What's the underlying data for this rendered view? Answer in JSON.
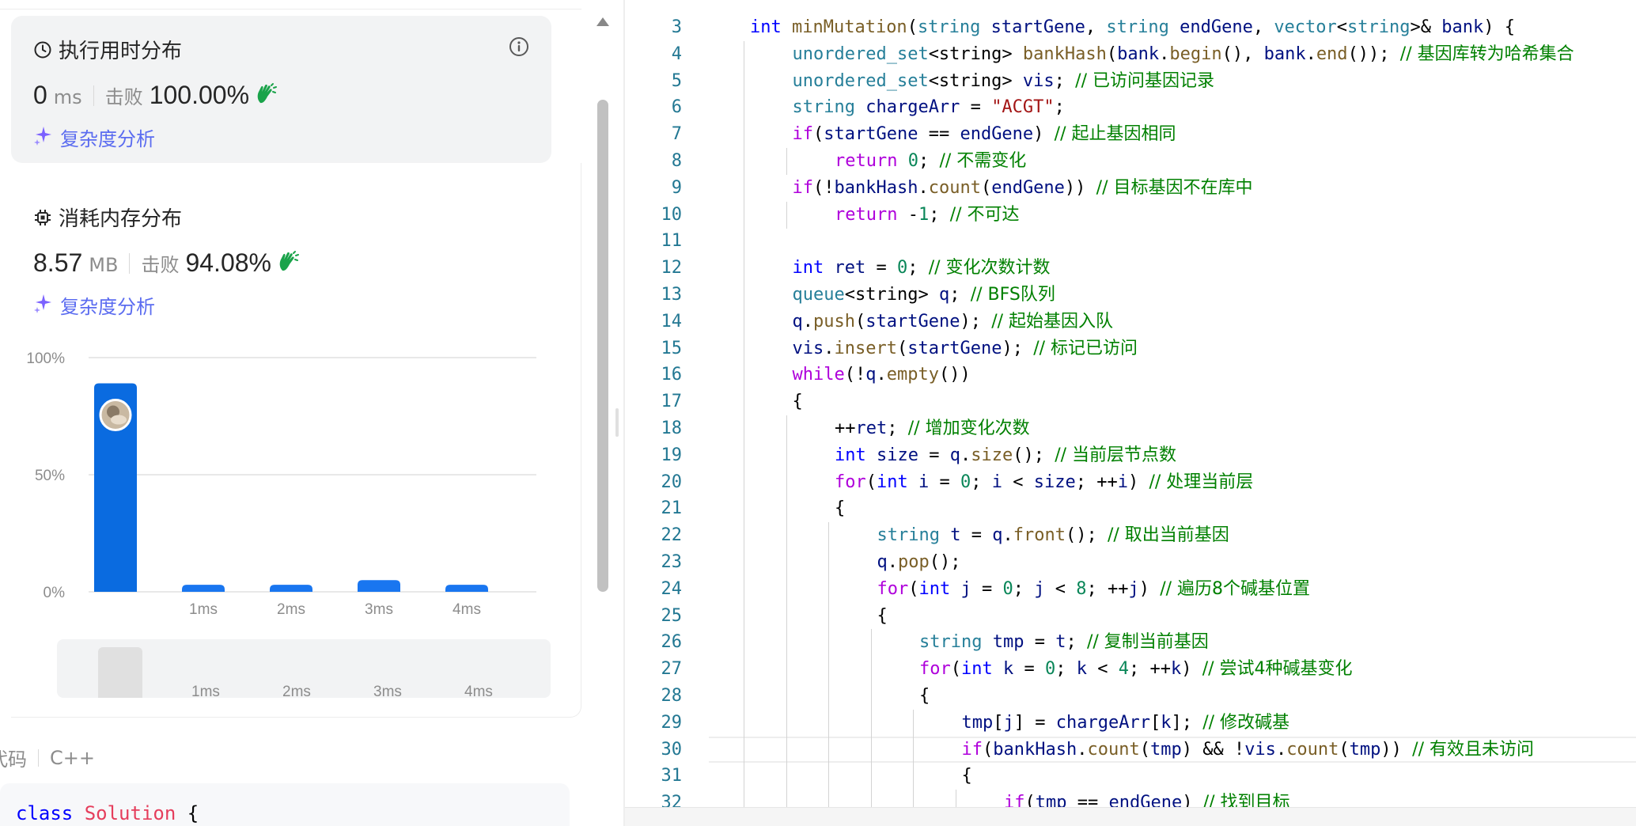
{
  "runtime": {
    "title": "执行用时分布",
    "value": "0",
    "unit": "ms",
    "beats_label": "击败",
    "beats_pct": "100.00%",
    "analysis_label": "复杂度分析"
  },
  "memory": {
    "title": "消耗内存分布",
    "value": "8.57",
    "unit": "MB",
    "beats_label": "击败",
    "beats_pct": "94.08%",
    "analysis_label": "复杂度分析"
  },
  "chart_data": {
    "type": "bar",
    "categories": [
      "",
      "1ms",
      "2ms",
      "3ms",
      "4ms"
    ],
    "values": [
      89,
      3,
      3,
      5,
      3
    ],
    "y_ticks": [
      "100%",
      "50%",
      "0%"
    ],
    "ylim": [
      0,
      100
    ],
    "bar_color": "#0a6be0",
    "highlight_color": "#1976f0",
    "grid": true
  },
  "mini_chart": {
    "labels": [
      "1ms",
      "2ms",
      "3ms",
      "4ms"
    ]
  },
  "code_header": {
    "label": "代码",
    "language": "C++"
  },
  "code_preview": {
    "text": "class Solution {"
  },
  "editor": {
    "current_line": 30,
    "lines": [
      {
        "n": 3,
        "indent": 1,
        "tokens": [
          [
            "kw",
            "int "
          ],
          [
            "fn",
            "minMutation"
          ],
          [
            "plain",
            "("
          ],
          [
            "type",
            "string "
          ],
          [
            "var",
            "startGene"
          ],
          [
            "plain",
            ", "
          ],
          [
            "type",
            "string "
          ],
          [
            "var",
            "endGene"
          ],
          [
            "plain",
            ", "
          ],
          [
            "type",
            "vector"
          ],
          [
            "plain",
            "<"
          ],
          [
            "type",
            "string"
          ],
          [
            "plain",
            ">& "
          ],
          [
            "var",
            "bank"
          ],
          [
            "plain",
            ") {"
          ]
        ]
      },
      {
        "n": 4,
        "indent": 2,
        "tokens": [
          [
            "type",
            "unordered_set"
          ],
          [
            "plain",
            "<string> "
          ],
          [
            "fn",
            "bankHash"
          ],
          [
            "plain",
            "("
          ],
          [
            "var",
            "bank"
          ],
          [
            "plain",
            "."
          ],
          [
            "fn",
            "begin"
          ],
          [
            "plain",
            "(), "
          ],
          [
            "var",
            "bank"
          ],
          [
            "plain",
            "."
          ],
          [
            "fn",
            "end"
          ],
          [
            "plain",
            "()); "
          ],
          [
            "cmt",
            "// 基因库转为哈希集合"
          ]
        ]
      },
      {
        "n": 5,
        "indent": 2,
        "tokens": [
          [
            "type",
            "unordered_set"
          ],
          [
            "plain",
            "<string> "
          ],
          [
            "var",
            "vis"
          ],
          [
            "plain",
            "; "
          ],
          [
            "cmt",
            "// 已访问基因记录"
          ]
        ]
      },
      {
        "n": 6,
        "indent": 2,
        "tokens": [
          [
            "type",
            "string "
          ],
          [
            "var",
            "chargeArr"
          ],
          [
            "plain",
            " = "
          ],
          [
            "str",
            "\"ACGT\""
          ],
          [
            "plain",
            ";"
          ]
        ]
      },
      {
        "n": 7,
        "indent": 2,
        "tokens": [
          [
            "ctrl",
            "if"
          ],
          [
            "plain",
            "("
          ],
          [
            "var",
            "startGene"
          ],
          [
            "plain",
            " == "
          ],
          [
            "var",
            "endGene"
          ],
          [
            "plain",
            ") "
          ],
          [
            "cmt",
            "// 起止基因相同"
          ]
        ]
      },
      {
        "n": 8,
        "indent": 3,
        "tokens": [
          [
            "ctrl",
            "return "
          ],
          [
            "num",
            "0"
          ],
          [
            "plain",
            "; "
          ],
          [
            "cmt",
            "// 不需变化"
          ]
        ]
      },
      {
        "n": 9,
        "indent": 2,
        "tokens": [
          [
            "ctrl",
            "if"
          ],
          [
            "plain",
            "(!"
          ],
          [
            "var",
            "bankHash"
          ],
          [
            "plain",
            "."
          ],
          [
            "fn",
            "count"
          ],
          [
            "plain",
            "("
          ],
          [
            "var",
            "endGene"
          ],
          [
            "plain",
            ")) "
          ],
          [
            "cmt",
            "// 目标基因不在库中"
          ]
        ]
      },
      {
        "n": 10,
        "indent": 3,
        "tokens": [
          [
            "ctrl",
            "return "
          ],
          [
            "plain",
            "-"
          ],
          [
            "num",
            "1"
          ],
          [
            "plain",
            "; "
          ],
          [
            "cmt",
            "// 不可达"
          ]
        ]
      },
      {
        "n": 11,
        "indent": 2,
        "tokens": []
      },
      {
        "n": 12,
        "indent": 2,
        "tokens": [
          [
            "kw",
            "int "
          ],
          [
            "var",
            "ret"
          ],
          [
            "plain",
            " = "
          ],
          [
            "num",
            "0"
          ],
          [
            "plain",
            "; "
          ],
          [
            "cmt",
            "// 变化次数计数"
          ]
        ]
      },
      {
        "n": 13,
        "indent": 2,
        "tokens": [
          [
            "type",
            "queue"
          ],
          [
            "plain",
            "<string> "
          ],
          [
            "var",
            "q"
          ],
          [
            "plain",
            "; "
          ],
          [
            "cmt",
            "// BFS队列"
          ]
        ]
      },
      {
        "n": 14,
        "indent": 2,
        "tokens": [
          [
            "var",
            "q"
          ],
          [
            "plain",
            "."
          ],
          [
            "fn",
            "push"
          ],
          [
            "plain",
            "("
          ],
          [
            "var",
            "startGene"
          ],
          [
            "plain",
            "); "
          ],
          [
            "cmt",
            "// 起始基因入队"
          ]
        ]
      },
      {
        "n": 15,
        "indent": 2,
        "tokens": [
          [
            "var",
            "vis"
          ],
          [
            "plain",
            "."
          ],
          [
            "fn",
            "insert"
          ],
          [
            "plain",
            "("
          ],
          [
            "var",
            "startGene"
          ],
          [
            "plain",
            "); "
          ],
          [
            "cmt",
            "// 标记已访问"
          ]
        ]
      },
      {
        "n": 16,
        "indent": 2,
        "tokens": [
          [
            "ctrl",
            "while"
          ],
          [
            "plain",
            "(!"
          ],
          [
            "var",
            "q"
          ],
          [
            "plain",
            "."
          ],
          [
            "fn",
            "empty"
          ],
          [
            "plain",
            "())"
          ]
        ]
      },
      {
        "n": 17,
        "indent": 2,
        "tokens": [
          [
            "plain",
            "{"
          ]
        ]
      },
      {
        "n": 18,
        "indent": 3,
        "tokens": [
          [
            "plain",
            "++"
          ],
          [
            "var",
            "ret"
          ],
          [
            "plain",
            "; "
          ],
          [
            "cmt",
            "// 增加变化次数"
          ]
        ]
      },
      {
        "n": 19,
        "indent": 3,
        "tokens": [
          [
            "kw",
            "int "
          ],
          [
            "var",
            "size"
          ],
          [
            "plain",
            " = "
          ],
          [
            "var",
            "q"
          ],
          [
            "plain",
            "."
          ],
          [
            "fn",
            "size"
          ],
          [
            "plain",
            "(); "
          ],
          [
            "cmt",
            "// 当前层节点数"
          ]
        ]
      },
      {
        "n": 20,
        "indent": 3,
        "tokens": [
          [
            "ctrl",
            "for"
          ],
          [
            "plain",
            "("
          ],
          [
            "kw",
            "int "
          ],
          [
            "var",
            "i"
          ],
          [
            "plain",
            " = "
          ],
          [
            "num",
            "0"
          ],
          [
            "plain",
            "; "
          ],
          [
            "var",
            "i"
          ],
          [
            "plain",
            " < "
          ],
          [
            "var",
            "size"
          ],
          [
            "plain",
            "; ++"
          ],
          [
            "var",
            "i"
          ],
          [
            "plain",
            ") "
          ],
          [
            "cmt",
            "// 处理当前层"
          ]
        ]
      },
      {
        "n": 21,
        "indent": 3,
        "tokens": [
          [
            "plain",
            "{"
          ]
        ]
      },
      {
        "n": 22,
        "indent": 4,
        "tokens": [
          [
            "type",
            "string "
          ],
          [
            "var",
            "t"
          ],
          [
            "plain",
            " = "
          ],
          [
            "var",
            "q"
          ],
          [
            "plain",
            "."
          ],
          [
            "fn",
            "front"
          ],
          [
            "plain",
            "(); "
          ],
          [
            "cmt",
            "// 取出当前基因"
          ]
        ]
      },
      {
        "n": 23,
        "indent": 4,
        "tokens": [
          [
            "var",
            "q"
          ],
          [
            "plain",
            "."
          ],
          [
            "fn",
            "pop"
          ],
          [
            "plain",
            "();"
          ]
        ]
      },
      {
        "n": 24,
        "indent": 4,
        "tokens": [
          [
            "ctrl",
            "for"
          ],
          [
            "plain",
            "("
          ],
          [
            "kw",
            "int "
          ],
          [
            "var",
            "j"
          ],
          [
            "plain",
            " = "
          ],
          [
            "num",
            "0"
          ],
          [
            "plain",
            "; "
          ],
          [
            "var",
            "j"
          ],
          [
            "plain",
            " < "
          ],
          [
            "num",
            "8"
          ],
          [
            "plain",
            "; ++"
          ],
          [
            "var",
            "j"
          ],
          [
            "plain",
            ") "
          ],
          [
            "cmt",
            "// 遍历8个碱基位置"
          ]
        ]
      },
      {
        "n": 25,
        "indent": 4,
        "tokens": [
          [
            "plain",
            "{"
          ]
        ]
      },
      {
        "n": 26,
        "indent": 5,
        "tokens": [
          [
            "type",
            "string "
          ],
          [
            "var",
            "tmp"
          ],
          [
            "plain",
            " = "
          ],
          [
            "var",
            "t"
          ],
          [
            "plain",
            "; "
          ],
          [
            "cmt",
            "// 复制当前基因"
          ]
        ]
      },
      {
        "n": 27,
        "indent": 5,
        "tokens": [
          [
            "ctrl",
            "for"
          ],
          [
            "plain",
            "("
          ],
          [
            "kw",
            "int "
          ],
          [
            "var",
            "k"
          ],
          [
            "plain",
            " = "
          ],
          [
            "num",
            "0"
          ],
          [
            "plain",
            "; "
          ],
          [
            "var",
            "k"
          ],
          [
            "plain",
            " < "
          ],
          [
            "num",
            "4"
          ],
          [
            "plain",
            "; ++"
          ],
          [
            "var",
            "k"
          ],
          [
            "plain",
            ") "
          ],
          [
            "cmt",
            "// 尝试4种碱基变化"
          ]
        ]
      },
      {
        "n": 28,
        "indent": 5,
        "tokens": [
          [
            "plain",
            "{"
          ]
        ]
      },
      {
        "n": 29,
        "indent": 6,
        "tokens": [
          [
            "var",
            "tmp"
          ],
          [
            "plain",
            "["
          ],
          [
            "var",
            "j"
          ],
          [
            "plain",
            "] = "
          ],
          [
            "var",
            "chargeArr"
          ],
          [
            "plain",
            "["
          ],
          [
            "var",
            "k"
          ],
          [
            "plain",
            "]; "
          ],
          [
            "cmt",
            "// 修改碱基"
          ]
        ]
      },
      {
        "n": 30,
        "indent": 6,
        "tokens": [
          [
            "ctrl",
            "if"
          ],
          [
            "plain",
            "("
          ],
          [
            "var",
            "bankHash"
          ],
          [
            "plain",
            "."
          ],
          [
            "fn",
            "count"
          ],
          [
            "plain",
            "("
          ],
          [
            "var",
            "tmp"
          ],
          [
            "plain",
            ") && !"
          ],
          [
            "var",
            "vis"
          ],
          [
            "plain",
            "."
          ],
          [
            "fn",
            "count"
          ],
          [
            "plain",
            "("
          ],
          [
            "var",
            "tmp"
          ],
          [
            "plain",
            ")) "
          ],
          [
            "cmt",
            "// 有效且未访问"
          ]
        ]
      },
      {
        "n": 31,
        "indent": 6,
        "tokens": [
          [
            "plain",
            "{"
          ]
        ]
      },
      {
        "n": 32,
        "indent": 7,
        "tokens": [
          [
            "ctrl",
            "if"
          ],
          [
            "plain",
            "("
          ],
          [
            "var",
            "tmp"
          ],
          [
            "plain",
            " == "
          ],
          [
            "var",
            "endGene"
          ],
          [
            "plain",
            ") "
          ],
          [
            "cmt",
            "// 找到目标"
          ]
        ]
      }
    ]
  }
}
